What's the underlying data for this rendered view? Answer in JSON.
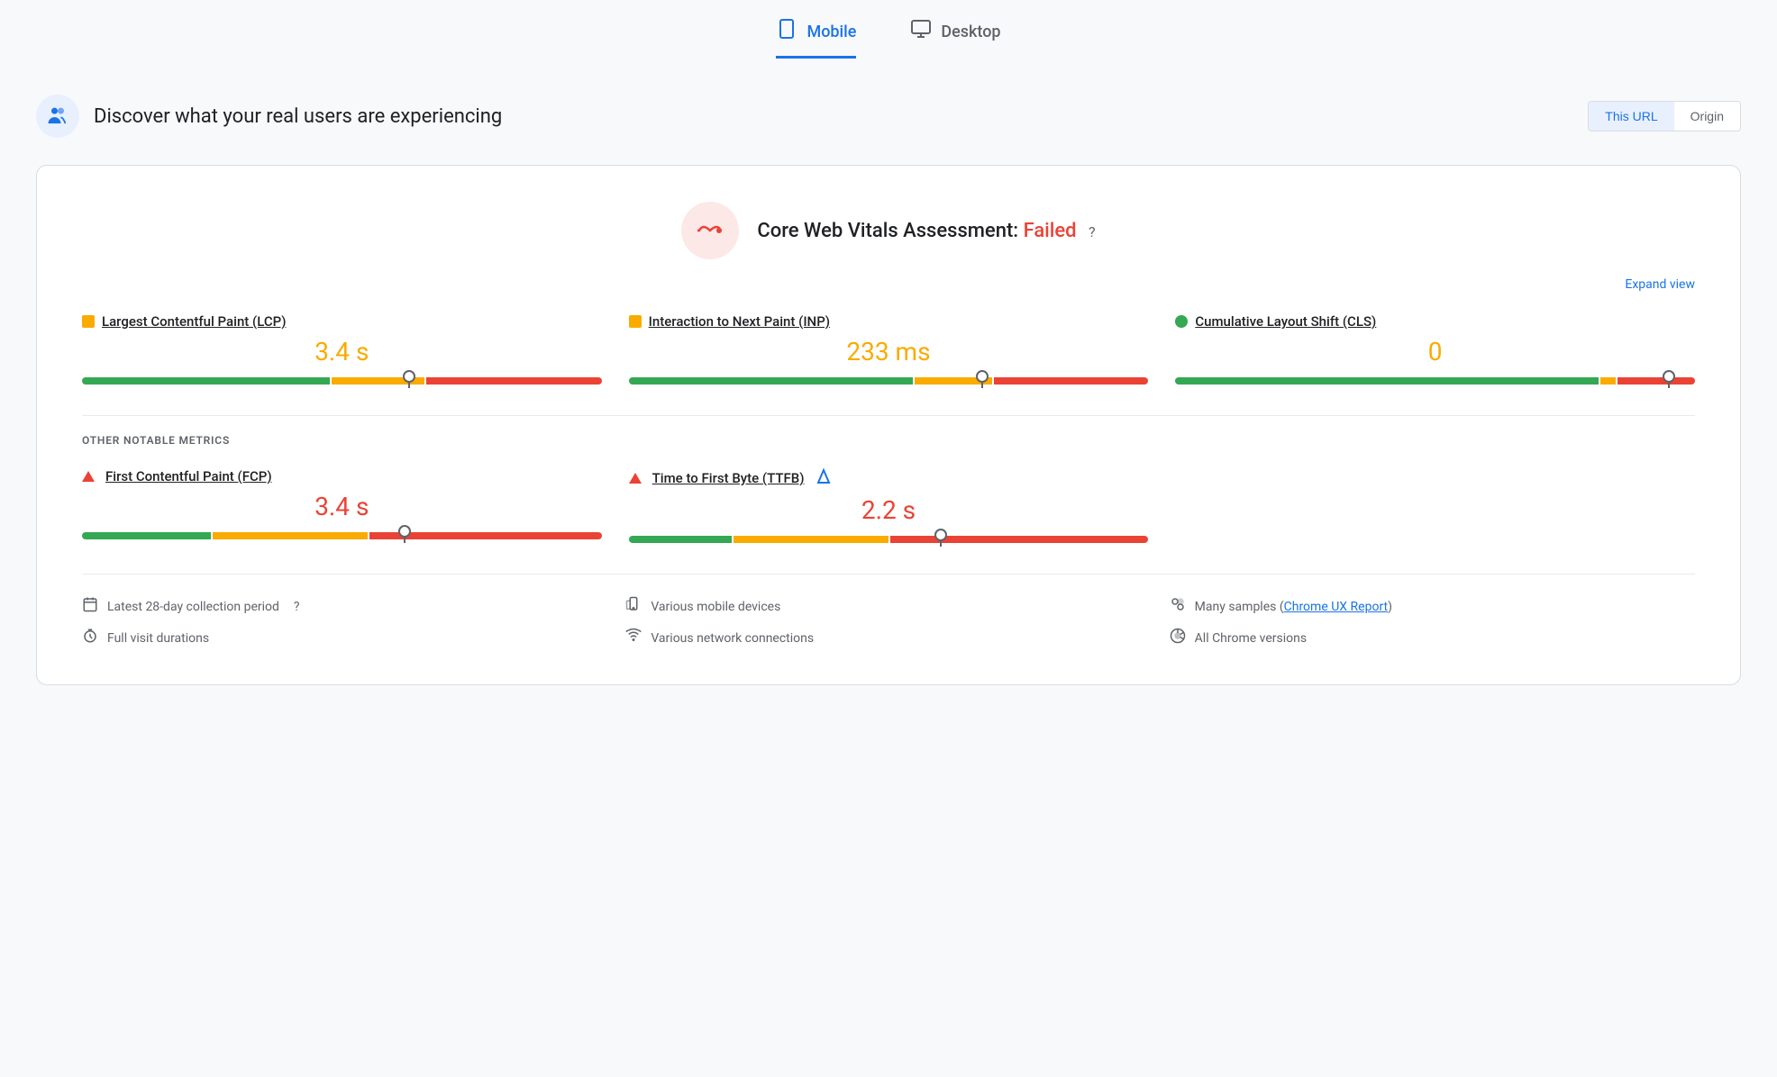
{
  "tabs": [
    {
      "id": "mobile",
      "label": "Mobile",
      "active": true,
      "icon": "📱"
    },
    {
      "id": "desktop",
      "label": "Desktop",
      "active": false,
      "icon": "🖥"
    }
  ],
  "header": {
    "title": "Discover what your real users are experiencing",
    "icon": "👥",
    "url_toggle": {
      "this_url": "This URL",
      "origin": "Origin"
    }
  },
  "assessment": {
    "title": "Core Web Vitals Assessment:",
    "status": "Failed",
    "expand_label": "Expand view"
  },
  "core_metrics": [
    {
      "id": "lcp",
      "label": "Largest Contentful Paint (LCP)",
      "dot_color": "orange",
      "value": "3.4 s",
      "value_color": "orange",
      "bar": {
        "green": 48,
        "orange": 18,
        "red": 34
      },
      "marker_pct": 63
    },
    {
      "id": "inp",
      "label": "Interaction to Next Paint (INP)",
      "dot_color": "orange",
      "value": "233 ms",
      "value_color": "orange",
      "bar": {
        "green": 55,
        "orange": 15,
        "red": 30
      },
      "marker_pct": 68
    },
    {
      "id": "cls",
      "label": "Cumulative Layout Shift (CLS)",
      "dot_color": "green",
      "value": "0",
      "value_color": "orange",
      "bar": {
        "green": 82,
        "orange": 3,
        "red": 15
      },
      "marker_pct": 95
    }
  ],
  "other_metrics_label": "OTHER NOTABLE METRICS",
  "other_metrics": [
    {
      "id": "fcp",
      "label": "First Contentful Paint (FCP)",
      "icon": "triangle-red",
      "value": "3.4 s",
      "value_color": "red",
      "bar": {
        "green": 25,
        "orange": 30,
        "red": 45
      },
      "marker_pct": 62
    },
    {
      "id": "ttfb",
      "label": "Time to First Byte (TTFB)",
      "icon": "triangle-red",
      "has_blue_triangle": true,
      "value": "2.2 s",
      "value_color": "red",
      "bar": {
        "green": 20,
        "orange": 30,
        "red": 50
      },
      "marker_pct": 60
    }
  ],
  "footer": {
    "col1": [
      {
        "icon": "📅",
        "text": "Latest 28-day collection period",
        "has_help": true
      },
      {
        "icon": "⏱",
        "text": "Full visit durations"
      }
    ],
    "col2": [
      {
        "icon": "📱",
        "text": "Various mobile devices"
      },
      {
        "icon": "📶",
        "text": "Various network connections"
      }
    ],
    "col3": [
      {
        "icon": "🔵",
        "text": "Many samples",
        "link": "Chrome UX Report"
      },
      {
        "icon": "⊙",
        "text": "All Chrome versions"
      }
    ]
  }
}
